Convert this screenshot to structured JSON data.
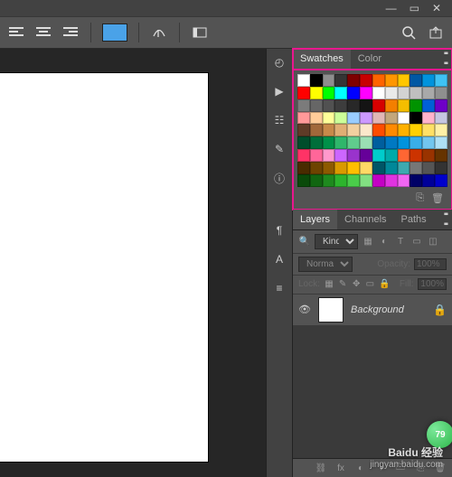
{
  "window": {
    "minimize": "—",
    "maximize": "▭",
    "close": "✕"
  },
  "options": {
    "color": "#4aa2e8"
  },
  "sidebar_icons": [
    "history-icon",
    "play-icon",
    "switches-icon",
    "brush-icon",
    "info-icon",
    "paragraph-icon",
    "type-icon",
    "align-icon"
  ],
  "swatches": {
    "tabs": {
      "swatches": "Swatches",
      "color": "Color"
    },
    "footer": {
      "new": "⎘",
      "trash": "🗑"
    },
    "colors": [
      "#ffffff",
      "#000000",
      "#8e8e8e",
      "#353535",
      "#7e0000",
      "#c80000",
      "#ff6400",
      "#ff9600",
      "#ffc700",
      "#0058a4",
      "#0093dd",
      "#3fc2f3",
      "#ff0000",
      "#ffff00",
      "#00ff00",
      "#00ffff",
      "#0000ff",
      "#ff00ff",
      "#ffffff",
      "#eaeaea",
      "#d3d3d3",
      "#bfbfbf",
      "#a9a9a9",
      "#8f8f8f",
      "#7b7b7b",
      "#666666",
      "#515151",
      "#3d3d3d",
      "#282828",
      "#141414",
      "#d60000",
      "#f47f00",
      "#f4be00",
      "#009300",
      "#0060d6",
      "#6e00c8",
      "#ff9999",
      "#ffcc99",
      "#ffff99",
      "#ccff99",
      "#99ccff",
      "#cc99ff",
      "#e2b6b6",
      "#c3a77b",
      "#ffffff",
      "#000000",
      "#ffb3cc",
      "#c6c6e2",
      "#5f3b27",
      "#a1683a",
      "#c88a4a",
      "#e0ae74",
      "#f2d0a0",
      "#fce8cb",
      "#ff4d00",
      "#ff8a00",
      "#ffb100",
      "#ffd000",
      "#ffe066",
      "#fff0a6",
      "#004d2b",
      "#006e3a",
      "#009149",
      "#2fb66b",
      "#60cc8d",
      "#9be0b4",
      "#005f9e",
      "#0079c2",
      "#0093dd",
      "#39aee8",
      "#72c6ef",
      "#aee0f6",
      "#ff3366",
      "#ff6699",
      "#ff99cc",
      "#cc66ff",
      "#9933cc",
      "#660099",
      "#00cccc",
      "#00aaaa",
      "#ff6633",
      "#cc3300",
      "#993300",
      "#663300",
      "#4a2b00",
      "#6e4300",
      "#8d5a00",
      "#d99a00",
      "#ffbf00",
      "#ffd966",
      "#005566",
      "#008899",
      "#3daaaf",
      "#777777",
      "#555555",
      "#333333",
      "#0a4a0a",
      "#116611",
      "#1e8a1e",
      "#2db42d",
      "#4acc4a",
      "#82e082",
      "#c400c4",
      "#e033e0",
      "#f266f2",
      "#000066",
      "#000099",
      "#0000cc"
    ]
  },
  "layers": {
    "tabs": {
      "layers": "Layers",
      "channels": "Channels",
      "paths": "Paths"
    },
    "filter_label": "Kind",
    "blend_mode": "Normal",
    "opacity_label": "Opacity:",
    "opacity_value": "100%",
    "lock_label": "Lock:",
    "fill_label": "Fill:",
    "fill_value": "100%",
    "row": {
      "name": "Background"
    }
  },
  "watermark": {
    "brand": "Baidu 经验",
    "url": "jingyan.baidu.com",
    "badge": "79"
  }
}
